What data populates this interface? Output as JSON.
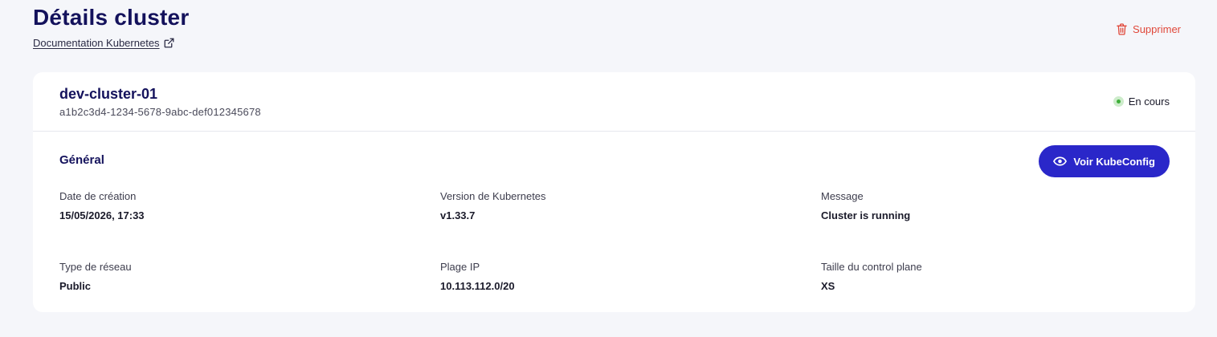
{
  "header": {
    "title": "Détails cluster",
    "doc_link": "Documentation Kubernetes",
    "delete_label": "Supprimer"
  },
  "cluster": {
    "name": "dev-cluster-01",
    "id": "a1b2c3d4-1234-5678-9abc-def012345678",
    "status": "En cours",
    "status_color": "#3fae3a"
  },
  "general": {
    "title": "Général",
    "kubeconfig_label": "Voir KubeConfig",
    "fields": [
      {
        "label": "Date de création",
        "value": "15/05/2026, 17:33"
      },
      {
        "label": "Version de Kubernetes",
        "value": "v1.33.7"
      },
      {
        "label": "Message",
        "value": "Cluster is running"
      },
      {
        "label": "Type de réseau",
        "value": "Public"
      },
      {
        "label": "Plage IP",
        "value": "10.113.112.0/20"
      },
      {
        "label": "Taille du control plane",
        "value": "XS"
      }
    ]
  },
  "colors": {
    "accent": "#2a27c9",
    "danger": "#e0483a",
    "title": "#14125c"
  }
}
